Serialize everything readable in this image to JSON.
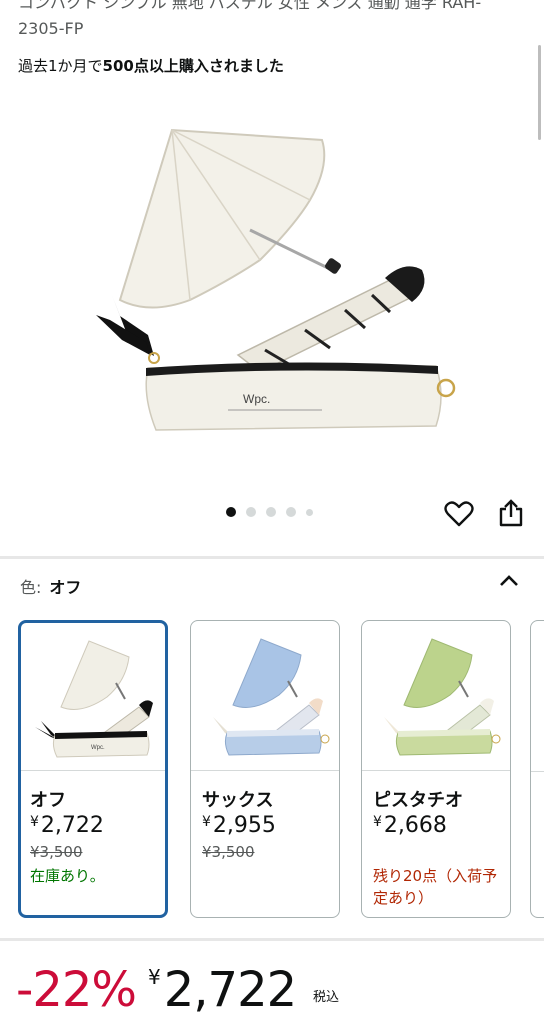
{
  "product": {
    "title_cut_1": "コンパクト シンプル 無地 パステル 女性 メンズ 通勤 通学 RAH-",
    "title_cut_2": "2305-FP",
    "bought_prefix": "過去1か月で",
    "bought_bold": "500点以上購入されました"
  },
  "carousel": {
    "dot_count": 5,
    "active_index": 0,
    "brand_logo": "Wpc."
  },
  "icons": {
    "favorite": "heart-icon",
    "share": "share-icon",
    "collapse": "chevron-up-icon"
  },
  "color_selector": {
    "label": "色:",
    "selected": "オフ",
    "options": [
      {
        "name": "オフ",
        "yen": "¥",
        "price": "2,722",
        "old_price": "¥3,500",
        "stock": "在庫あり。",
        "umbrella_color": "#f1efe6",
        "case_color": "#f1efe6"
      },
      {
        "name": "サックス",
        "yen": "¥",
        "price": "2,955",
        "old_price": "¥3,500",
        "stock": "",
        "umbrella_color": "#a9c4e6",
        "case_color": "#b7cde8"
      },
      {
        "name": "ピスタチオ",
        "yen": "¥",
        "price": "2,668",
        "old_price": "",
        "stock": "残り20点（入荷予定あり）",
        "umbrella_color": "#bcd38c",
        "case_color": "#c9da9e"
      }
    ]
  },
  "price_block": {
    "discount": "-22%",
    "yen": "¥",
    "price": "2,722",
    "tax": "税込"
  },
  "colors": {
    "accent_selected": "#2162a1",
    "discount_red": "#cc0c39",
    "in_stock_green": "#007600",
    "low_stock_red": "#b12704"
  }
}
